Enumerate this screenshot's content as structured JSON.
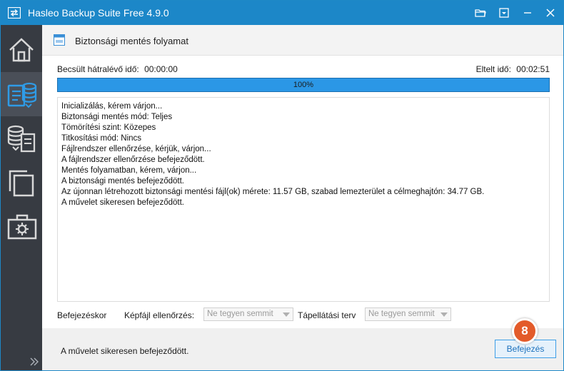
{
  "window": {
    "title": "Hasleo Backup Suite Free 4.9.0"
  },
  "titlebar": {
    "buttons": [
      "folder-icon",
      "menu-dropdown-icon",
      "minimize-icon",
      "close-icon"
    ]
  },
  "sidebar": {
    "items": [
      {
        "name": "home",
        "icon": "home-icon",
        "active": false
      },
      {
        "name": "backup",
        "icon": "backup-icon",
        "active": true
      },
      {
        "name": "restore",
        "icon": "restore-icon",
        "active": false
      },
      {
        "name": "clone",
        "icon": "clone-icon",
        "active": false
      },
      {
        "name": "tools",
        "icon": "toolbox-icon",
        "active": false
      }
    ]
  },
  "header": {
    "title": "Biztonsági mentés folyamat"
  },
  "time": {
    "remaining_label": "Becsült hátralévő idő:",
    "remaining_value": "00:00:00",
    "elapsed_label": "Eltelt idő:",
    "elapsed_value": "00:02:51"
  },
  "progress": {
    "percent": 100,
    "label": "100%"
  },
  "log": {
    "lines": [
      "Inicializálás, kérem várjon...",
      "Biztonsági mentés mód: Teljes",
      "Tömörítési szint: Közepes",
      "Titkosítási mód: Nincs",
      "Fájlrendszer ellenőrzése, kérjük, várjon...",
      "A fájlrendszer ellenőrzése befejeződött.",
      "Mentés folyamatban, kérem, várjon...",
      "A biztonsági mentés befejeződött.",
      "Az újonnan létrehozott biztonsági mentési fájl(ok) mérete: 11.57 GB, szabad lemezterület a célmeghajtón: 34.77 GB.",
      "A művelet sikeresen befejeződött."
    ]
  },
  "options": {
    "on_finish_label": "Befejezéskor",
    "image_check_label": "Képfájl ellenőrzés:",
    "image_check_value": "Ne tegyen semmit",
    "power_plan_label": "Tápellátási terv",
    "power_plan_value": "Ne tegyen semmit"
  },
  "footer": {
    "status": "A művelet sikeresen befejeződött.",
    "finish_label": "Befejezés",
    "step_badge": "8"
  },
  "colors": {
    "accent": "#1c87c8",
    "sidebar": "#373b42",
    "progress": "#2b97e6",
    "badge": "#e35b2a"
  }
}
